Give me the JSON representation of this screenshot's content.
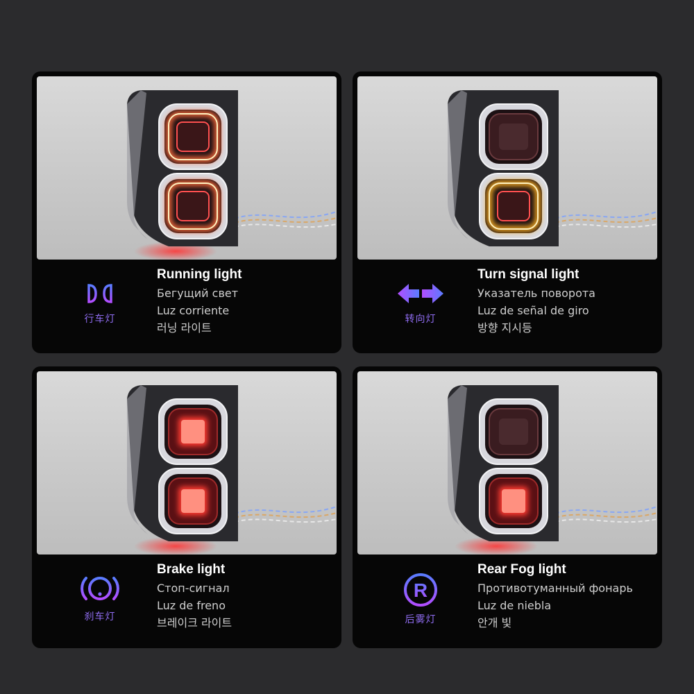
{
  "panels": [
    {
      "mode": "running",
      "title": "Running light",
      "line1": "Бегущий свет",
      "line2": "Luz corriente",
      "line3": "러닝 라이트",
      "icon_name": "running-light-icon",
      "icon_caption": "行车灯"
    },
    {
      "mode": "turn",
      "title": "Turn signal light",
      "line1": "Указатель поворота",
      "line2": "Luz de señal de giro",
      "line3": "방향 지시등",
      "icon_name": "turn-signal-arrows-icon",
      "icon_caption": "转向灯"
    },
    {
      "mode": "brake",
      "title": "Brake light",
      "line1": "Стоп-сигнал",
      "line2": "Luz de freno",
      "line3": "브레이크 라이트",
      "icon_name": "brake-warning-icon",
      "icon_caption": "刹车灯"
    },
    {
      "mode": "fog",
      "title": "Rear Fog light",
      "line1": "Противотуманный фонарь",
      "line2": "Luz de niebla",
      "line3": "안개 빛",
      "icon_name": "rear-fog-r-icon",
      "icon_caption": "后雾灯",
      "icon_letter": "R"
    }
  ],
  "colors": {
    "background": "#2b2b2d",
    "card": "#060606",
    "icon_gradient_top": "#5a7cff",
    "icon_gradient_bottom": "#b24dff",
    "caption": "#8f6cf0",
    "glow_red": "#ff2a2a",
    "glow_amber": "#ffb020"
  }
}
